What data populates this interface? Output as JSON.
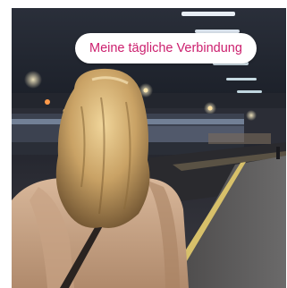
{
  "tag": {
    "label": "Meine tägliche Verbindung"
  },
  "colors": {
    "accent": "#cc1f6e",
    "pill_background": "#ffffff"
  },
  "image": {
    "subject": "woman-on-train-platform"
  }
}
